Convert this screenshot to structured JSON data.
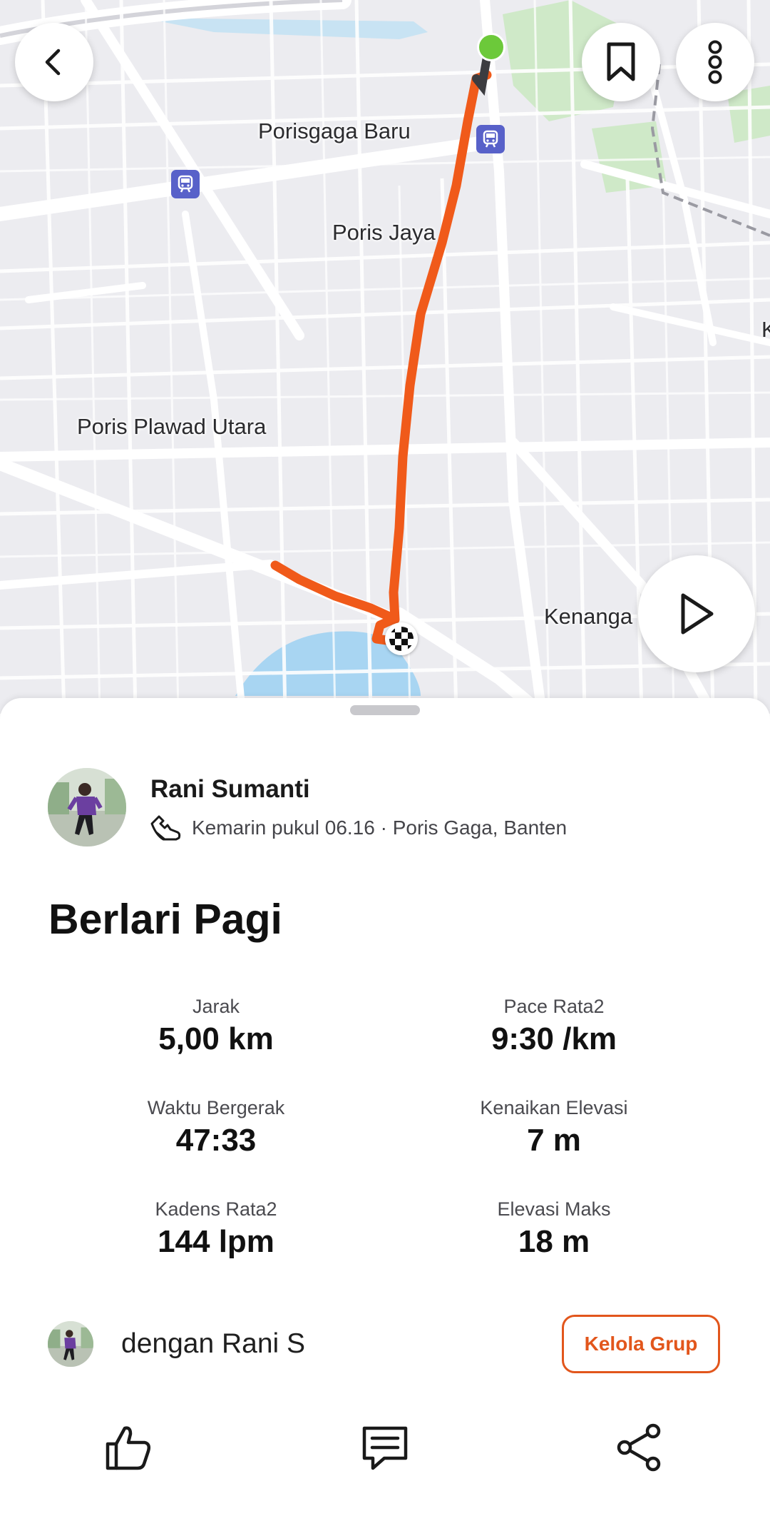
{
  "map": {
    "labels": {
      "porisgaga_baru": "Porisgaga Baru",
      "poris_jaya": "Poris Jaya",
      "poris_plawad_utara": "Poris Plawad Utara",
      "kenanga": "Kenanga",
      "edge_fragment": "K"
    },
    "route_color": "#f05a1a",
    "start_color": "#6cc93a"
  },
  "top_bar": {
    "back_icon": "chevron-left-icon",
    "bookmark_icon": "bookmark-icon",
    "more_icon": "more-vertical-icon"
  },
  "play_icon": "play-icon",
  "activity": {
    "athlete_name": "Rani Sumanti",
    "meta": "Kemarin pukul 06.16 · Poris Gaga, Banten",
    "sport_icon": "running-shoe-icon",
    "title": "Berlari Pagi",
    "stats": [
      {
        "label": "Jarak",
        "value": "5,00 km"
      },
      {
        "label": "Pace Rata2",
        "value": "9:30 /km"
      },
      {
        "label": "Waktu Bergerak",
        "value": "47:33"
      },
      {
        "label": "Kenaikan Elevasi",
        "value": "7 m"
      },
      {
        "label": "Kadens Rata2",
        "value": "144 lpm"
      },
      {
        "label": "Elevasi Maks",
        "value": "18 m"
      }
    ]
  },
  "group": {
    "text": "dengan Rani S",
    "manage_label": "Kelola Grup"
  },
  "actions": {
    "like_icon": "thumbs-up-icon",
    "comment_icon": "comment-icon",
    "share_icon": "share-icon"
  },
  "colors": {
    "accent": "#e2561c",
    "map_background": "#ececf0",
    "water": "#a8d5f2",
    "park": "#cfe9c8"
  }
}
